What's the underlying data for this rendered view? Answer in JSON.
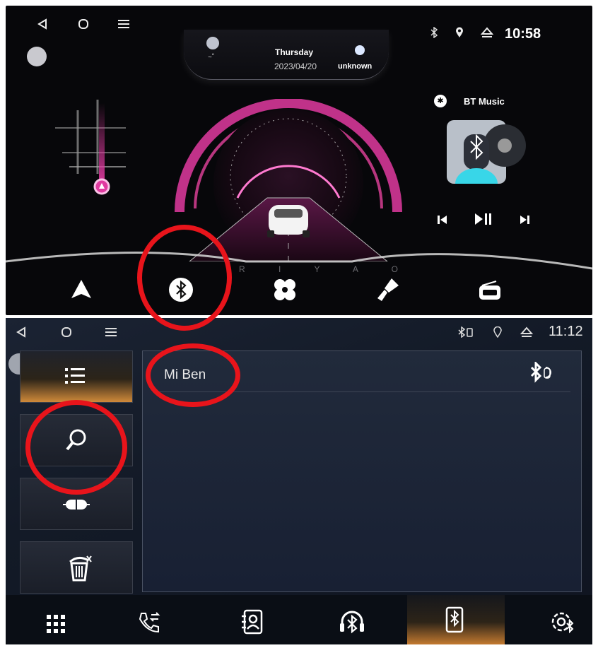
{
  "top_screen": {
    "status_bar": {
      "clock": "10:58",
      "icons": [
        "back-triangle-icon",
        "home-circle-icon",
        "menu-lines-icon",
        "bluetooth-icon",
        "location-pin-icon",
        "eject-icon"
      ]
    },
    "date_widget": {
      "day": "Thursday",
      "date": "2023/04/20",
      "weather": "unknown"
    },
    "music_widget": {
      "title": "BT Music",
      "controls": [
        "previous-icon",
        "play-pause-icon",
        "next-icon"
      ]
    },
    "brand_watermark": "R I Y A O",
    "dock": [
      "navigation-icon",
      "bluetooth-icon",
      "apps-icon",
      "brush-icon",
      "radio-icon"
    ]
  },
  "bottom_screen": {
    "status_bar": {
      "clock": "11:12",
      "icons": [
        "back-triangle-icon",
        "home-circle-icon",
        "menu-lines-icon",
        "bluetooth-battery-icon",
        "location-pin-icon",
        "eject-icon"
      ]
    },
    "sidebar": [
      "device-list-icon",
      "search-icon",
      "connect-plug-icon",
      "delete-trash-icon"
    ],
    "devices": [
      {
        "name": "Mi Ben"
      }
    ],
    "bottom_nav": [
      "keypad-icon",
      "call-log-icon",
      "contacts-icon",
      "bt-music-icon",
      "bt-device-icon",
      "bt-settings-icon"
    ]
  },
  "colors": {
    "accent_pink": "#e03aa0",
    "annotation_red": "#e8141b",
    "active_orange": "#d08a3a"
  }
}
